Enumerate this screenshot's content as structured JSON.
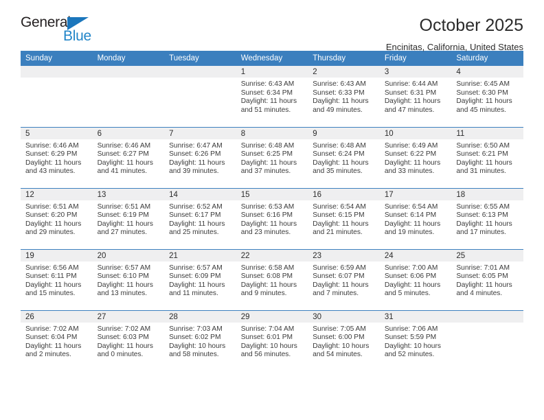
{
  "logo": {
    "word_top": "General",
    "word_bottom": "Blue",
    "triangle_color": "#1b76bc",
    "blue_color": "#2185c8"
  },
  "header": {
    "title": "October 2025",
    "subtitle": "Encinitas, California, United States"
  },
  "theme": {
    "header_bg": "#3b7fbe",
    "daynum_bg": "#efeff0",
    "text": "#2b2b2b"
  },
  "weekday_headers": [
    "Sunday",
    "Monday",
    "Tuesday",
    "Wednesday",
    "Thursday",
    "Friday",
    "Saturday"
  ],
  "weeks": [
    [
      {
        "empty": true
      },
      {
        "empty": true
      },
      {
        "empty": true
      },
      {
        "day": "1",
        "sunrise": "Sunrise: 6:43 AM",
        "sunset": "Sunset: 6:34 PM",
        "daylight": "Daylight: 11 hours and 51 minutes."
      },
      {
        "day": "2",
        "sunrise": "Sunrise: 6:43 AM",
        "sunset": "Sunset: 6:33 PM",
        "daylight": "Daylight: 11 hours and 49 minutes."
      },
      {
        "day": "3",
        "sunrise": "Sunrise: 6:44 AM",
        "sunset": "Sunset: 6:31 PM",
        "daylight": "Daylight: 11 hours and 47 minutes."
      },
      {
        "day": "4",
        "sunrise": "Sunrise: 6:45 AM",
        "sunset": "Sunset: 6:30 PM",
        "daylight": "Daylight: 11 hours and 45 minutes."
      }
    ],
    [
      {
        "day": "5",
        "sunrise": "Sunrise: 6:46 AM",
        "sunset": "Sunset: 6:29 PM",
        "daylight": "Daylight: 11 hours and 43 minutes."
      },
      {
        "day": "6",
        "sunrise": "Sunrise: 6:46 AM",
        "sunset": "Sunset: 6:27 PM",
        "daylight": "Daylight: 11 hours and 41 minutes."
      },
      {
        "day": "7",
        "sunrise": "Sunrise: 6:47 AM",
        "sunset": "Sunset: 6:26 PM",
        "daylight": "Daylight: 11 hours and 39 minutes."
      },
      {
        "day": "8",
        "sunrise": "Sunrise: 6:48 AM",
        "sunset": "Sunset: 6:25 PM",
        "daylight": "Daylight: 11 hours and 37 minutes."
      },
      {
        "day": "9",
        "sunrise": "Sunrise: 6:48 AM",
        "sunset": "Sunset: 6:24 PM",
        "daylight": "Daylight: 11 hours and 35 minutes."
      },
      {
        "day": "10",
        "sunrise": "Sunrise: 6:49 AM",
        "sunset": "Sunset: 6:22 PM",
        "daylight": "Daylight: 11 hours and 33 minutes."
      },
      {
        "day": "11",
        "sunrise": "Sunrise: 6:50 AM",
        "sunset": "Sunset: 6:21 PM",
        "daylight": "Daylight: 11 hours and 31 minutes."
      }
    ],
    [
      {
        "day": "12",
        "sunrise": "Sunrise: 6:51 AM",
        "sunset": "Sunset: 6:20 PM",
        "daylight": "Daylight: 11 hours and 29 minutes."
      },
      {
        "day": "13",
        "sunrise": "Sunrise: 6:51 AM",
        "sunset": "Sunset: 6:19 PM",
        "daylight": "Daylight: 11 hours and 27 minutes."
      },
      {
        "day": "14",
        "sunrise": "Sunrise: 6:52 AM",
        "sunset": "Sunset: 6:17 PM",
        "daylight": "Daylight: 11 hours and 25 minutes."
      },
      {
        "day": "15",
        "sunrise": "Sunrise: 6:53 AM",
        "sunset": "Sunset: 6:16 PM",
        "daylight": "Daylight: 11 hours and 23 minutes."
      },
      {
        "day": "16",
        "sunrise": "Sunrise: 6:54 AM",
        "sunset": "Sunset: 6:15 PM",
        "daylight": "Daylight: 11 hours and 21 minutes."
      },
      {
        "day": "17",
        "sunrise": "Sunrise: 6:54 AM",
        "sunset": "Sunset: 6:14 PM",
        "daylight": "Daylight: 11 hours and 19 minutes."
      },
      {
        "day": "18",
        "sunrise": "Sunrise: 6:55 AM",
        "sunset": "Sunset: 6:13 PM",
        "daylight": "Daylight: 11 hours and 17 minutes."
      }
    ],
    [
      {
        "day": "19",
        "sunrise": "Sunrise: 6:56 AM",
        "sunset": "Sunset: 6:11 PM",
        "daylight": "Daylight: 11 hours and 15 minutes."
      },
      {
        "day": "20",
        "sunrise": "Sunrise: 6:57 AM",
        "sunset": "Sunset: 6:10 PM",
        "daylight": "Daylight: 11 hours and 13 minutes."
      },
      {
        "day": "21",
        "sunrise": "Sunrise: 6:57 AM",
        "sunset": "Sunset: 6:09 PM",
        "daylight": "Daylight: 11 hours and 11 minutes."
      },
      {
        "day": "22",
        "sunrise": "Sunrise: 6:58 AM",
        "sunset": "Sunset: 6:08 PM",
        "daylight": "Daylight: 11 hours and 9 minutes."
      },
      {
        "day": "23",
        "sunrise": "Sunrise: 6:59 AM",
        "sunset": "Sunset: 6:07 PM",
        "daylight": "Daylight: 11 hours and 7 minutes."
      },
      {
        "day": "24",
        "sunrise": "Sunrise: 7:00 AM",
        "sunset": "Sunset: 6:06 PM",
        "daylight": "Daylight: 11 hours and 5 minutes."
      },
      {
        "day": "25",
        "sunrise": "Sunrise: 7:01 AM",
        "sunset": "Sunset: 6:05 PM",
        "daylight": "Daylight: 11 hours and 4 minutes."
      }
    ],
    [
      {
        "day": "26",
        "sunrise": "Sunrise: 7:02 AM",
        "sunset": "Sunset: 6:04 PM",
        "daylight": "Daylight: 11 hours and 2 minutes."
      },
      {
        "day": "27",
        "sunrise": "Sunrise: 7:02 AM",
        "sunset": "Sunset: 6:03 PM",
        "daylight": "Daylight: 11 hours and 0 minutes."
      },
      {
        "day": "28",
        "sunrise": "Sunrise: 7:03 AM",
        "sunset": "Sunset: 6:02 PM",
        "daylight": "Daylight: 10 hours and 58 minutes."
      },
      {
        "day": "29",
        "sunrise": "Sunrise: 7:04 AM",
        "sunset": "Sunset: 6:01 PM",
        "daylight": "Daylight: 10 hours and 56 minutes."
      },
      {
        "day": "30",
        "sunrise": "Sunrise: 7:05 AM",
        "sunset": "Sunset: 6:00 PM",
        "daylight": "Daylight: 10 hours and 54 minutes."
      },
      {
        "day": "31",
        "sunrise": "Sunrise: 7:06 AM",
        "sunset": "Sunset: 5:59 PM",
        "daylight": "Daylight: 10 hours and 52 minutes."
      },
      {
        "empty": true
      }
    ]
  ]
}
